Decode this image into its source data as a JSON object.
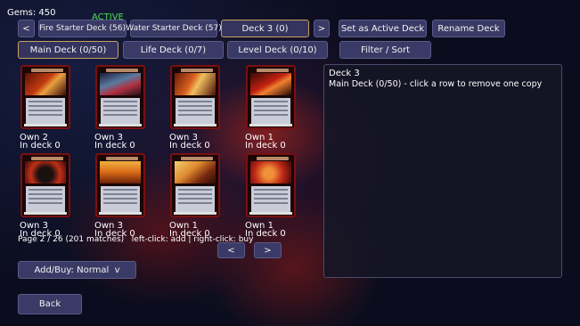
{
  "gems": "Gems: 450",
  "active_badge": "ACTIVE",
  "deck_nav": {
    "prev_label": "<",
    "decks": [
      "Fire Starter Deck (56)",
      "Water Starter Deck (57)",
      "Deck 3 (0)"
    ],
    "next_label": ">",
    "set_active_label": "Set as Active Deck",
    "rename_label": "Rename Deck"
  },
  "section_tabs": [
    "Main Deck (0/50)",
    "Life Deck (0/7)",
    "Level Deck (0/10)"
  ],
  "filter_label": "Filter / Sort",
  "cards": [
    {
      "own": "Own 2",
      "in_deck": "In deck 0"
    },
    {
      "own": "Own 3",
      "in_deck": "In deck 0"
    },
    {
      "own": "Own 3",
      "in_deck": "In deck 0"
    },
    {
      "own": "Own 1",
      "in_deck": "In deck 0"
    },
    {
      "own": "Own 3",
      "in_deck": "In deck 0"
    },
    {
      "own": "Own 3",
      "in_deck": "In deck 0"
    },
    {
      "own": "Own 1",
      "in_deck": "In deck 0"
    },
    {
      "own": "Own 1",
      "in_deck": "In deck 0"
    }
  ],
  "page_info": "Page 2 / 26 (201 matches)   left-click: add | right-click: buy",
  "pager": {
    "prev_label": "<",
    "next_label": ">"
  },
  "addbuy_label": "Add/Buy: Normal  v",
  "back_label": "Back",
  "panel": {
    "title": "Deck 3",
    "subtitle": "Main Deck (0/50) - click a row to remove one copy"
  }
}
